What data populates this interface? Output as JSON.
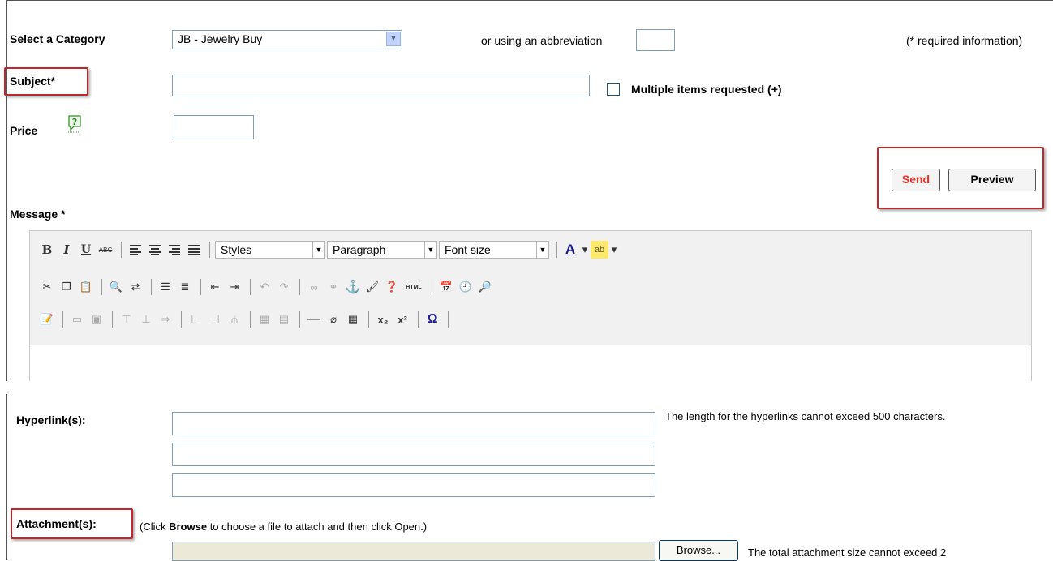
{
  "form": {
    "category_label": "Select a Category",
    "category_value": "JB - Jewelry Buy",
    "abbrev_label": "or using an abbreviation",
    "required_note": "(* required information)",
    "subject_label": "Subject*",
    "multiple_label": "Multiple items requested (+)",
    "price_label": "Price",
    "send_label": "Send",
    "preview_label": "Preview",
    "message_label": "Message *"
  },
  "editor": {
    "styles_label": "Styles",
    "paragraph_label": "Paragraph",
    "fontsize_label": "Font size",
    "bold": "B",
    "italic": "I",
    "underline": "U",
    "strike": "ABC",
    "html_btn": "HTML",
    "subscript": "x₂",
    "superscript": "x²",
    "omega": "Ω",
    "font_color": "A",
    "highlight": "ab"
  },
  "links": {
    "hyperlinks_label": "Hyperlink(s):",
    "hyperlinks_note": "The length for the hyperlinks cannot exceed 500 characters.",
    "attachments_label": "Attachment(s):",
    "attach_pre": "(Click ",
    "attach_bold": "Browse",
    "attach_post": " to choose a file to attach and then click Open.)",
    "browse_label": "Browse...",
    "attach_note": "The total attachment size cannot exceed 2"
  },
  "colors": {
    "highlight_red": "#c0272d",
    "send_red": "#e5302a",
    "help_green": "#3a8f2f"
  }
}
